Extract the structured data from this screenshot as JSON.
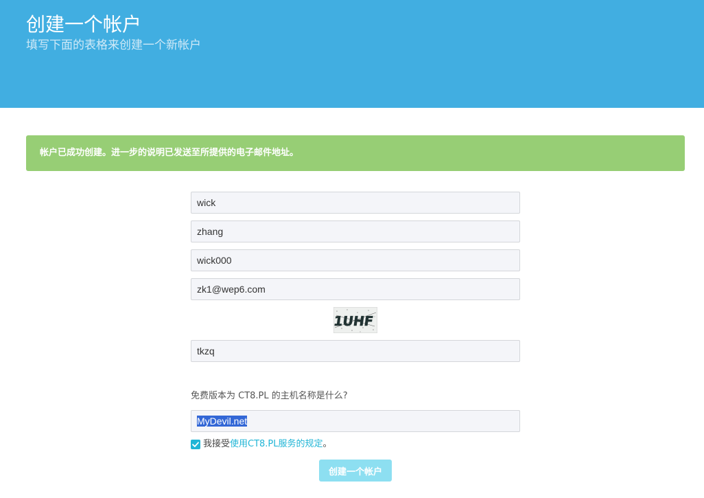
{
  "header": {
    "title": "创建一个帐户",
    "subtitle": "填写下面的表格来创建一个新帐户"
  },
  "alert": {
    "message": "帐户已成功创建。进一步的说明已发送至所提供的电子邮件地址。",
    "color": "#97ce75"
  },
  "form": {
    "first_name": "wick",
    "last_name": "zhang",
    "username": "wick000",
    "email": "zk1@wep6.com",
    "captcha_image_text": "1UHF",
    "captcha_answer": "tkzq",
    "question": "免费版本为 CT8.PL 的主机名称是什么?",
    "question_answer": "MyDevil.net",
    "accept_prefix": "我接受",
    "accept_link": "使用CT8.PL服务的规定",
    "accept_suffix": "。",
    "terms_accepted": true,
    "submit_label": "创建一个帐户"
  },
  "colors": {
    "header_bg": "#41aee1",
    "accent": "#20b5d6",
    "submit_bg": "#8ddff1"
  }
}
